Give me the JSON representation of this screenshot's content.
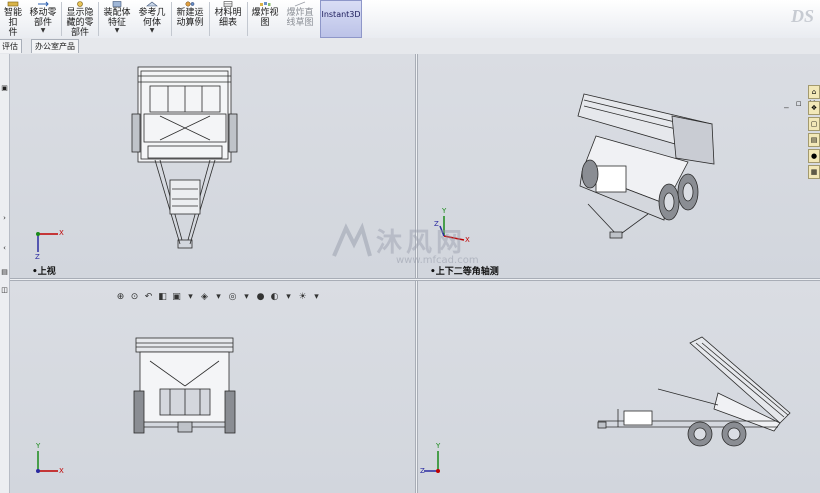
{
  "command_manager": {
    "buttons": [
      {
        "id": "smart-fastener",
        "label_line1": "智能扣",
        "label_line2": "件",
        "has_dropdown": false,
        "enabled": true,
        "icon": "fastener-icon"
      },
      {
        "id": "move-component",
        "label_line1": "移动零",
        "label_line2": "部件",
        "has_dropdown": true,
        "enabled": true,
        "icon": "move-icon"
      },
      {
        "id": "show-hidden",
        "label_line1": "显示隐",
        "label_line2": "藏的零",
        "label_line3": "部件",
        "has_dropdown": false,
        "enabled": true,
        "icon": "show-hidden-icon"
      },
      {
        "id": "assembly-feature",
        "label_line1": "装配体",
        "label_line2": "特征",
        "has_dropdown": true,
        "enabled": true,
        "icon": "assembly-feature-icon"
      },
      {
        "id": "reference-geometry",
        "label_line1": "参考几",
        "label_line2": "何体",
        "has_dropdown": true,
        "enabled": true,
        "icon": "reference-geometry-icon"
      },
      {
        "id": "new-motion-study",
        "label_line1": "新建运",
        "label_line2": "动算例",
        "has_dropdown": false,
        "enabled": true,
        "icon": "motion-study-icon"
      },
      {
        "id": "bill-of-materials",
        "label_line1": "材料明",
        "label_line2": "细表",
        "has_dropdown": false,
        "enabled": true,
        "icon": "bom-icon"
      },
      {
        "id": "exploded-view",
        "label_line1": "爆炸视",
        "label_line2": "图",
        "has_dropdown": false,
        "enabled": true,
        "icon": "exploded-view-icon"
      },
      {
        "id": "explode-line-sketch",
        "label_line1": "爆炸直",
        "label_line2": "线草图",
        "has_dropdown": false,
        "enabled": false,
        "icon": "explode-line-icon"
      }
    ],
    "instant3d": "Instant3D"
  },
  "tabs": [
    {
      "label": "评估"
    },
    {
      "label": "办公室产品"
    }
  ],
  "viewports": {
    "top_left": {
      "label": "•上视"
    },
    "top_right": {
      "label": "•上下二等角轴测"
    },
    "bottom_left": {
      "label": ""
    },
    "bottom_right": {
      "label": ""
    }
  },
  "triad": {
    "x": "X",
    "y": "Y",
    "z": "Z"
  },
  "watermark": {
    "text": "沐风网",
    "url": "www.mfcad.com"
  },
  "colors": {
    "accent": "#bcc3e8",
    "viewport_bg": "#d6d9df",
    "axis_x": "#c00000",
    "axis_y": "#1a8a1a",
    "axis_z": "#2a2aa0"
  }
}
